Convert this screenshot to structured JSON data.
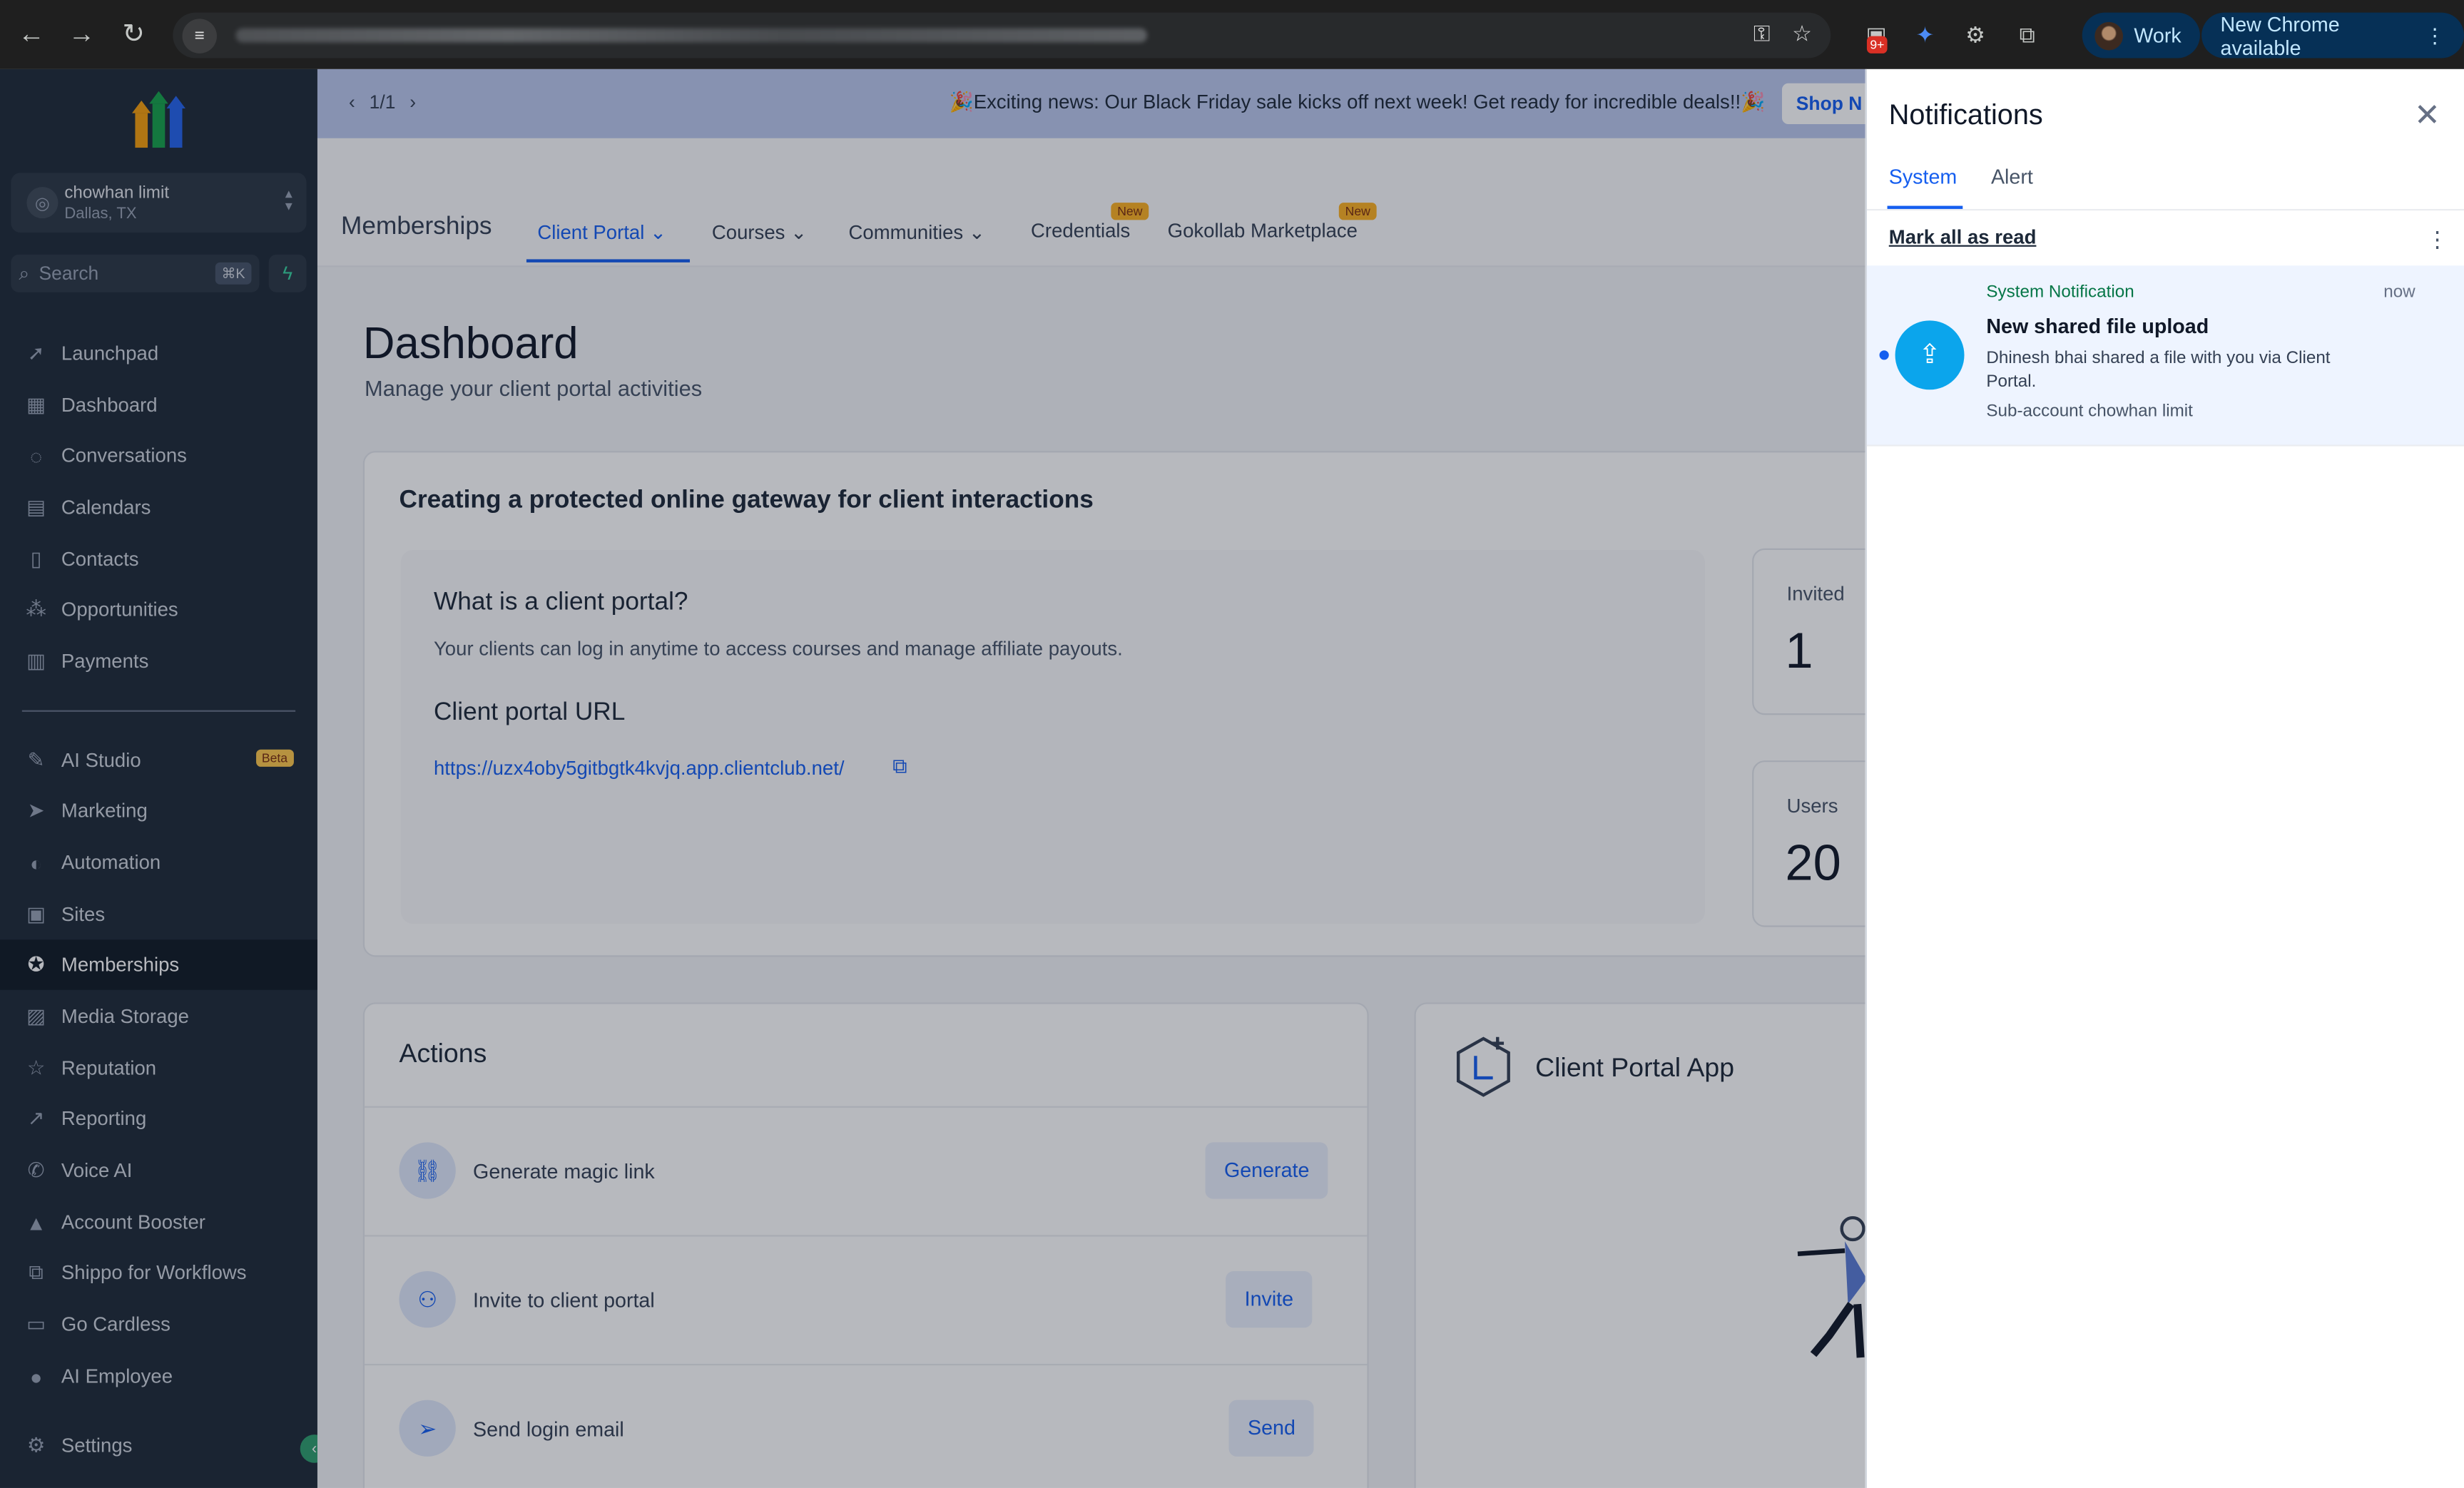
{
  "browser": {
    "notif_badge": "9+",
    "profile_label": "Work",
    "update_label": "New Chrome available"
  },
  "sidebar": {
    "account": {
      "name": "chowhan limit",
      "location": "Dallas, TX"
    },
    "search": {
      "placeholder": "Search",
      "shortcut": "⌘K"
    },
    "items": [
      {
        "label": "Launchpad",
        "icon": "rocket-icon"
      },
      {
        "label": "Dashboard",
        "icon": "grid-icon"
      },
      {
        "label": "Conversations",
        "icon": "chat-icon"
      },
      {
        "label": "Calendars",
        "icon": "calendar-icon"
      },
      {
        "label": "Contacts",
        "icon": "contacts-icon"
      },
      {
        "label": "Opportunities",
        "icon": "funnel-icon"
      },
      {
        "label": "Payments",
        "icon": "receipt-icon"
      },
      {
        "label": "AI Studio",
        "icon": "ai-icon",
        "badge": "Beta"
      },
      {
        "label": "Marketing",
        "icon": "send-icon"
      },
      {
        "label": "Automation",
        "icon": "automation-icon"
      },
      {
        "label": "Sites",
        "icon": "sites-icon"
      },
      {
        "label": "Memberships",
        "icon": "award-icon",
        "active": true
      },
      {
        "label": "Media Storage",
        "icon": "image-icon"
      },
      {
        "label": "Reputation",
        "icon": "star-icon"
      },
      {
        "label": "Reporting",
        "icon": "trend-icon"
      },
      {
        "label": "Voice AI",
        "icon": "phone-icon"
      },
      {
        "label": "Account Booster",
        "icon": "booster-icon"
      },
      {
        "label": "Shippo for Workflows",
        "icon": "workflow-icon"
      },
      {
        "label": "Go Cardless",
        "icon": "card-icon"
      },
      {
        "label": "AI Employee",
        "icon": "person-icon"
      },
      {
        "label": "Settings",
        "icon": "gear-icon"
      }
    ]
  },
  "banner": {
    "pager": "1/1",
    "message": "🎉Exciting news: Our Black Friday sale kicks off next week! Get ready for incredible deals!!🎉",
    "button": "Shop N"
  },
  "header": {
    "title": "Memberships",
    "tabs": [
      {
        "label": "Client Portal",
        "dropdown": true,
        "selected": true
      },
      {
        "label": "Courses",
        "dropdown": true
      },
      {
        "label": "Communities",
        "dropdown": true
      },
      {
        "label": "Credentials",
        "badge": "New"
      },
      {
        "label": "Gokollab Marketplace",
        "badge": "New"
      }
    ]
  },
  "dashboard": {
    "title": "Dashboard",
    "subtitle": "Manage your client portal activities",
    "gateway_title": "Creating a protected online gateway for client interactions",
    "what_title": "What is a client portal?",
    "what_text": "Your clients can log in anytime to access courses and manage affiliate payouts.",
    "url_title": "Client portal URL",
    "url": "https://uzx4oby5gitbgtk4kvjq.app.clientclub.net/",
    "stats": [
      {
        "label": "Invited",
        "value": "1"
      },
      {
        "label": "Users",
        "value": "20"
      }
    ],
    "actions_title": "Actions",
    "actions": [
      {
        "label": "Generate magic link",
        "button": "Generate",
        "icon": "magic-link-icon"
      },
      {
        "label": "Invite to client portal",
        "button": "Invite",
        "icon": "user-plus-icon"
      },
      {
        "label": "Send login email",
        "button": "Send",
        "icon": "paper-plane-icon"
      }
    ],
    "app_title": "Client Portal App"
  },
  "notifications": {
    "title": "Notifications",
    "tabs": [
      {
        "label": "System",
        "selected": true
      },
      {
        "label": "Alert"
      }
    ],
    "mark_all": "Mark all as read",
    "items": [
      {
        "kind": "System Notification",
        "time": "now",
        "title": "New shared file upload",
        "body": "Dhinesh bhai shared a file with you via Client Portal.",
        "subaccount": "Sub-account chowhan limit",
        "unread": true
      }
    ]
  },
  "colors": {
    "accent": "#155eef",
    "sidebar_bg": "#1f2a37",
    "banner_bg": "#bac8ec",
    "notif_icon": "#0ba5ec"
  }
}
